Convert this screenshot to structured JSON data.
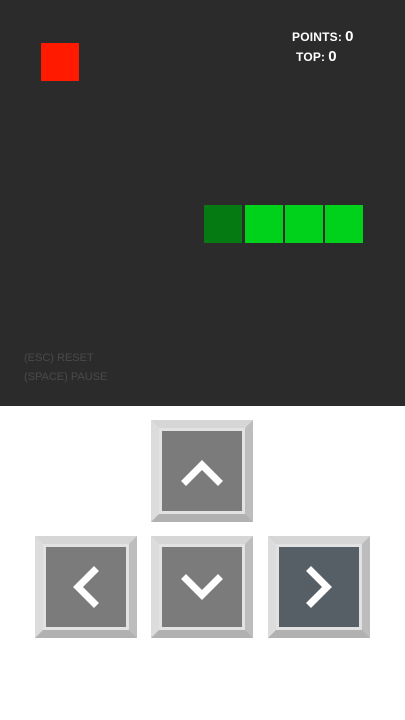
{
  "scoreboard": {
    "points_label": "POINTS:",
    "points_value": "0",
    "top_label": "TOP:",
    "top_value": "0"
  },
  "hints": {
    "reset": "(ESC) RESET",
    "pause": "(SPACE) PAUSE"
  },
  "controls": {
    "up_icon": "chevron-up-icon",
    "left_icon": "chevron-left-icon",
    "down_icon": "chevron-down-icon",
    "right_icon": "chevron-right-icon",
    "active_key": "right"
  },
  "colors": {
    "board_background": "#2b2b2b",
    "food": "#ff1a00",
    "snake_body": "#00d21b",
    "snake_head": "#067a12"
  },
  "game_state": {
    "snake_length": 4,
    "direction": "left"
  }
}
